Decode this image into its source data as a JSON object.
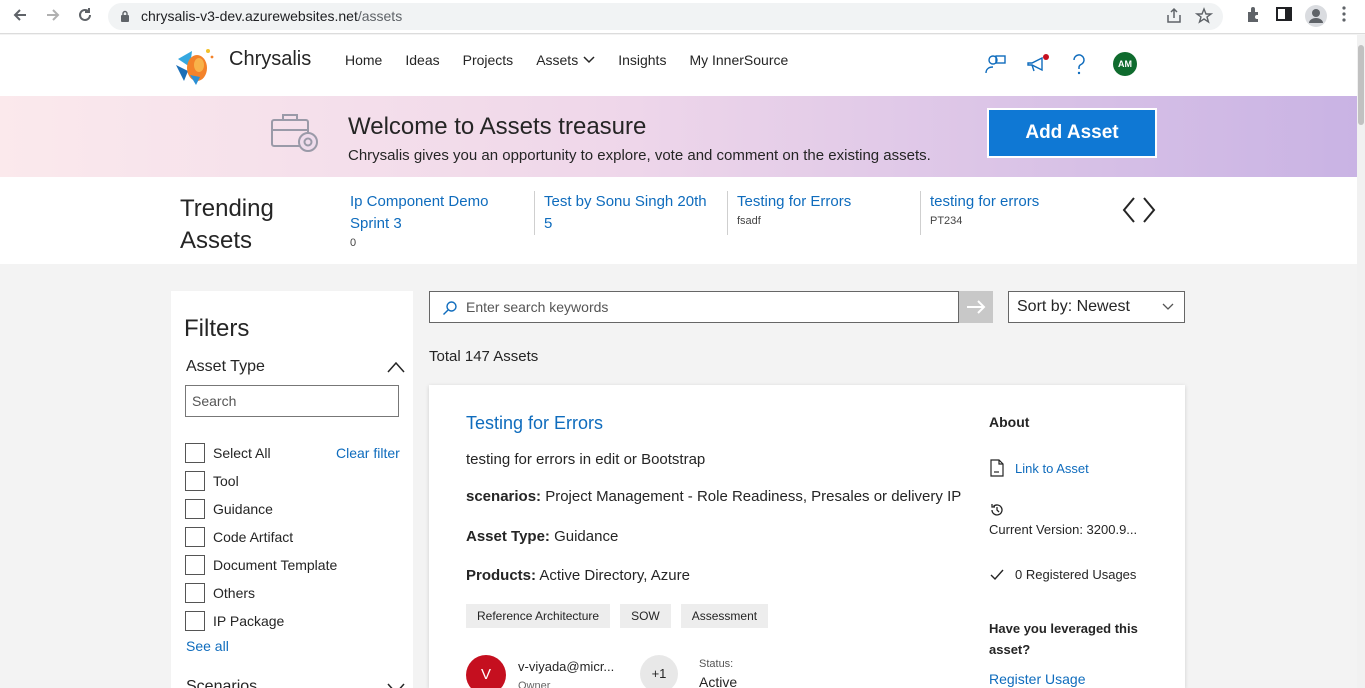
{
  "browser": {
    "url_host": "chrysalis-v3-dev.azurewebsites.net",
    "url_path": "/assets"
  },
  "header": {
    "brand": "Chrysalis",
    "nav": [
      "Home",
      "Ideas",
      "Projects",
      "Assets",
      "Insights",
      "My InnerSource"
    ],
    "avatar_initials": "AM"
  },
  "banner": {
    "title": "Welcome to Assets treasure",
    "subtitle": "Chrysalis gives you an opportunity to explore, vote and comment on the existing assets.",
    "add_button": "Add Asset"
  },
  "trending": {
    "title": "Trending Assets",
    "items": [
      {
        "title": "Ip Component Demo Sprint 3",
        "sub": "0"
      },
      {
        "title": "Test by Sonu Singh 20th 5",
        "sub": ""
      },
      {
        "title": "Testing for Errors",
        "sub": "fsadf"
      },
      {
        "title": "testing for errors",
        "sub": "PT234"
      }
    ]
  },
  "filters": {
    "title": "Filters",
    "asset_type_label": "Asset Type",
    "search_placeholder": "Search",
    "clear_filter": "Clear filter",
    "options": [
      "Select All",
      "Tool",
      "Guidance",
      "Code Artifact",
      "Document Template",
      "Others",
      "IP Package"
    ],
    "see_all": "See all",
    "scenarios_label": "Scenarios"
  },
  "search": {
    "placeholder": "Enter search keywords",
    "sort_label": "Sort by: Newest"
  },
  "results": {
    "total": "Total 147 Assets"
  },
  "card": {
    "title": "Testing for Errors",
    "description": "testing for errors in edit or Bootstrap",
    "scenarios_label": "scenarios:",
    "scenarios_value": " Project Management - Role Readiness, Presales or delivery IP",
    "asset_type_label": "Asset Type:",
    "asset_type_value": " Guidance",
    "products_label": "Products:",
    "products_value": " Active Directory, Azure",
    "tags": [
      "Reference Architecture",
      "SOW",
      "Assessment"
    ],
    "owner_initial": "V",
    "owner_name": "v-viyada@micr...",
    "owner_role": "Owner",
    "extra_owners": "+1",
    "status_label": "Status:",
    "status_value": "Active",
    "about_title": "About",
    "link_to_asset": "Link to Asset",
    "current_version": "Current Version: 3200.9...",
    "registered_usages": "0 Registered Usages",
    "leveraged_question": "Have you leveraged this asset?",
    "register_usage": "Register Usage"
  },
  "colors": {
    "link": "#0f6cbd",
    "primary_button": "#0f78d4",
    "avatar_green": "#0f6b2e",
    "owner_red": "#c50f1f"
  }
}
